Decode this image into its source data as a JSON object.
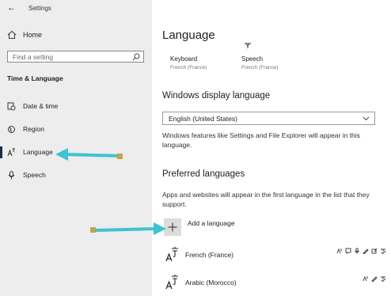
{
  "window": {
    "title": "Settings"
  },
  "sidebar": {
    "home_label": "Home",
    "search_placeholder": "Find a setting",
    "section": "Time & Language",
    "items": [
      {
        "label": "Date & time",
        "icon": "clock-icon"
      },
      {
        "label": "Region",
        "icon": "globe-icon"
      },
      {
        "label": "Language",
        "icon": "language-icon",
        "active": true
      },
      {
        "label": "Speech",
        "icon": "microphone-icon"
      }
    ]
  },
  "main": {
    "title": "Language",
    "features": [
      {
        "label": "Keyboard",
        "sub": "French (France)",
        "icon": "keyboard-icon"
      },
      {
        "label": "Speech",
        "sub": "French (France)",
        "icon": "speech-icon"
      }
    ],
    "display_language": {
      "heading": "Windows display language",
      "selected": "English (United States)",
      "description": "Windows features like Settings and File Explorer will appear in this language."
    },
    "preferred": {
      "heading": "Preferred languages",
      "description": "Apps and websites will appear in the first language in the list that they support.",
      "add_label": "Add a language",
      "languages": [
        {
          "name": "French (France)"
        },
        {
          "name": "Arabic (Morocco)"
        }
      ]
    }
  },
  "colors": {
    "accent_arrow": "#3ec3d3",
    "sidebar_bg": "#ededed"
  }
}
